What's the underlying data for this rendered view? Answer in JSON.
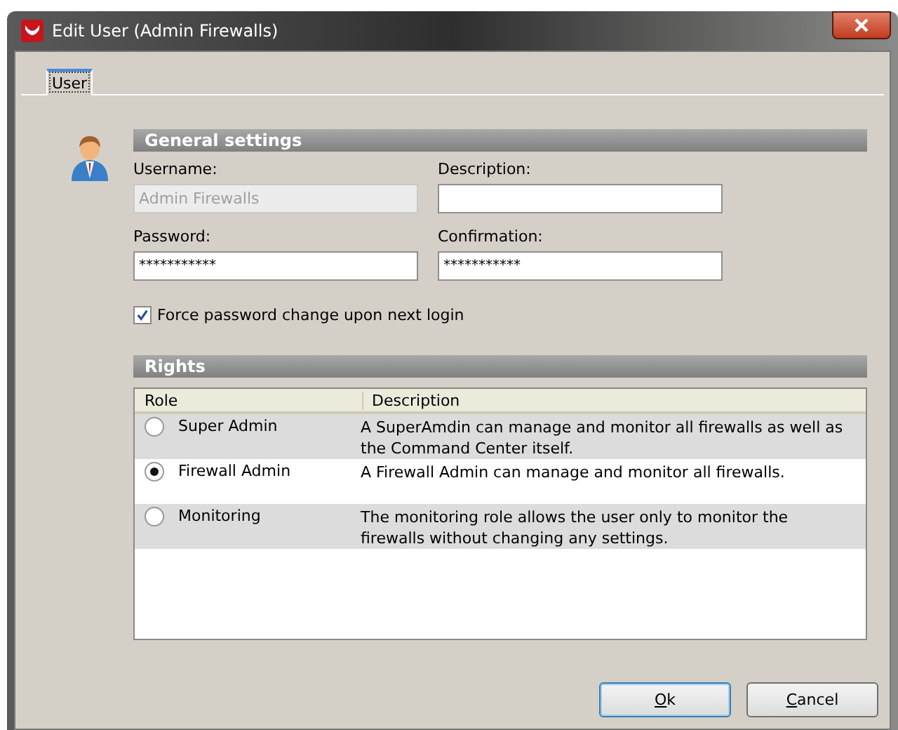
{
  "window": {
    "title": "Edit User (Admin Firewalls)"
  },
  "tabs": [
    {
      "label": "User",
      "selected": true
    }
  ],
  "general_settings": {
    "title": "General settings",
    "fields": [
      {
        "label": "Username:",
        "value": "Admin Firewalls",
        "disabled": true,
        "kind": "text"
      },
      {
        "label": "Description:",
        "disabled": false,
        "kind": "text"
      },
      {
        "label": "Password:",
        "value": "***********",
        "disabled": false,
        "kind": "password"
      },
      {
        "label": "Confirmation:",
        "value": "***********",
        "disabled": false,
        "kind": "password"
      }
    ],
    "force_password_change": {
      "label": "Force password change upon next login",
      "checked": true
    }
  },
  "rights": {
    "title": "Rights",
    "columns": [
      "Role",
      "Description"
    ],
    "rows": [
      {
        "role": "Super Admin",
        "description": "A SuperAmdin can manage and monitor all firewalls as well as the Command Center itself.",
        "selected": false
      },
      {
        "role": "Firewall Admin",
        "description": "A Firewall Admin can manage and monitor all firewalls.",
        "selected": true
      },
      {
        "role": "Monitoring",
        "description": "The monitoring role allows the user only to monitor the firewalls without changing any settings.",
        "selected": false
      }
    ]
  },
  "buttons": [
    {
      "label": "Ok",
      "default": true
    },
    {
      "label": "Cancel",
      "default": false
    }
  ]
}
